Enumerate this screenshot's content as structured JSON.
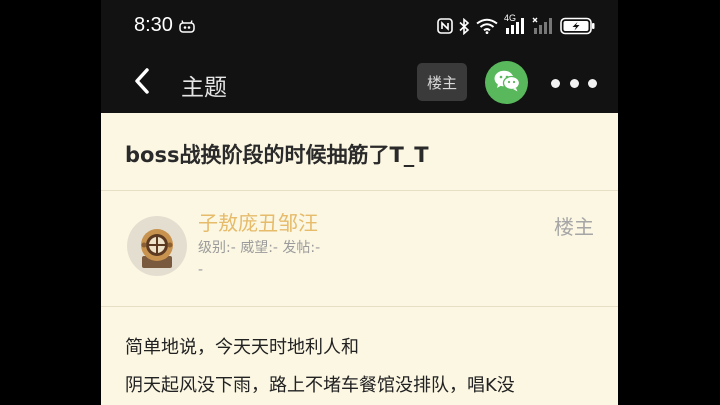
{
  "status_bar": {
    "time": "8:30",
    "icons": [
      "notification-icon",
      "nfc-icon",
      "bluetooth-icon",
      "wifi-icon",
      "signal-4g-icon",
      "signal-no-sim-icon",
      "battery-charging-icon"
    ],
    "network_label": "4G"
  },
  "nav": {
    "title": "主题",
    "op_button": "楼主",
    "icons": [
      "back-arrow-icon",
      "wechat-icon",
      "more-icon"
    ]
  },
  "post": {
    "title": "boss战换阶段的时候抽筋了T_T",
    "author": {
      "name": "子敖庞丑邹汪",
      "meta": "级别:- 威望:- 发帖:-",
      "meta_extra": "-",
      "role": "楼主"
    },
    "body_lines": [
      "简单地说，今天天时地利人和",
      "阴天起风没下雨，路上不堵车餐馆没排队，唱K没"
    ]
  },
  "colors": {
    "background": "#121212",
    "content_bg": "#fbf7e3",
    "username": "#e6bb6a",
    "wechat_green": "#58b85b"
  }
}
